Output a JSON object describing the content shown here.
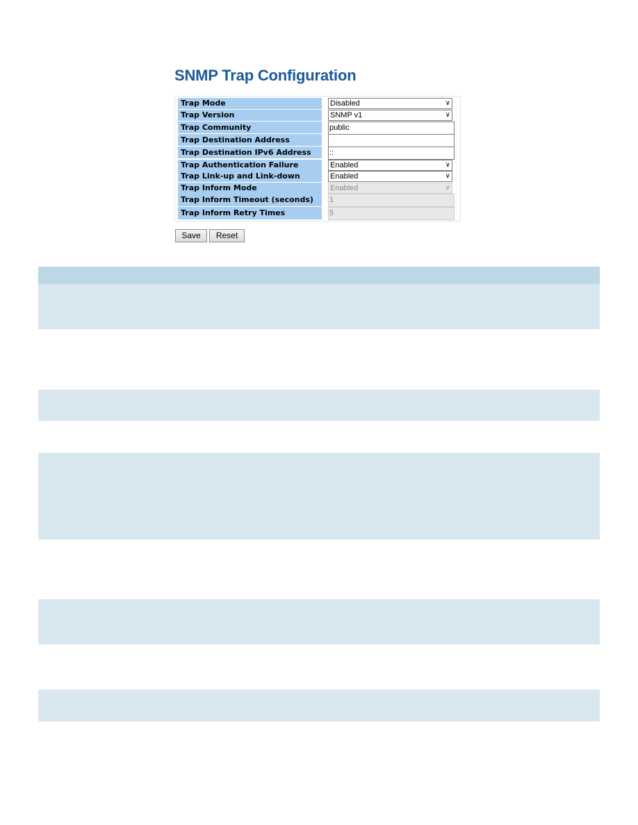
{
  "page": {
    "title": "SNMP Trap Configuration"
  },
  "config": {
    "fields": [
      {
        "label": "Trap Mode",
        "type": "select",
        "value": "Disabled",
        "disabled": false
      },
      {
        "label": "Trap Version",
        "type": "select",
        "value": "SNMP v1",
        "disabled": false
      },
      {
        "label": "Trap Community",
        "type": "text",
        "value": "public",
        "disabled": false
      },
      {
        "label": "Trap Destination Address",
        "type": "text",
        "value": "",
        "disabled": false
      },
      {
        "label": "Trap Destination IPv6 Address",
        "type": "text",
        "value": "::",
        "disabled": false
      },
      {
        "label": "Trap Authentication Failure",
        "type": "select",
        "value": "Enabled",
        "disabled": false
      },
      {
        "label": "Trap Link-up and Link-down",
        "type": "select",
        "value": "Enabled",
        "disabled": false
      },
      {
        "label": "Trap Inform Mode",
        "type": "select",
        "value": "Enabled",
        "disabled": true
      },
      {
        "label": "Trap Inform Timeout (seconds)",
        "type": "text",
        "value": "1",
        "disabled": true
      },
      {
        "label": "Trap Inform Retry Times",
        "type": "text",
        "value": "5",
        "disabled": true
      }
    ],
    "chevron_icon": "chevron-down-icon"
  },
  "buttons": {
    "save_label": "Save",
    "reset_label": "Reset"
  },
  "description_table": {
    "header": "",
    "rows": [
      "",
      "",
      "",
      "",
      "",
      "",
      "",
      "",
      ""
    ]
  },
  "colors": {
    "title": "#1a5a9a",
    "label_bg": "#a7cdf0",
    "table_header_bg": "#bcd8e4",
    "table_row_shade": "#d9e7f0"
  }
}
